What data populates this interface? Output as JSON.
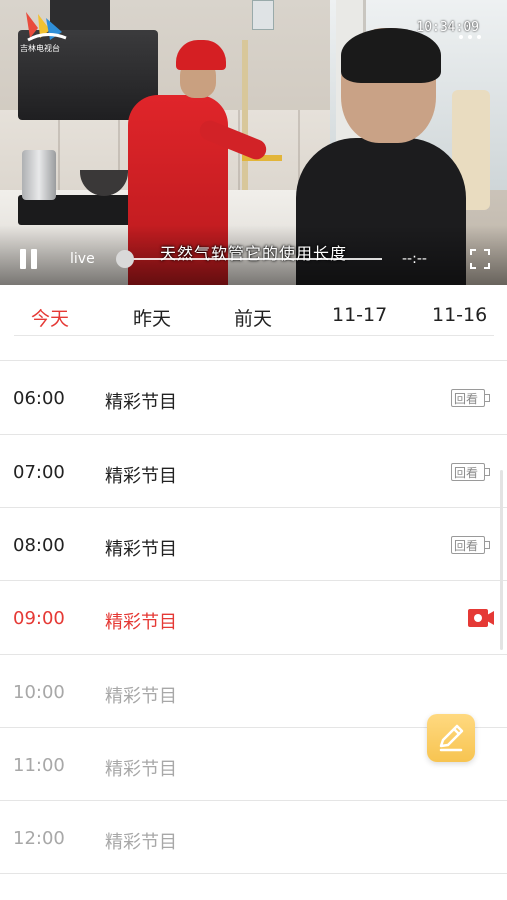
{
  "player": {
    "logo_text": "吉林电视台",
    "clock": "10:34:09",
    "subtitle": "天然气软管它的使用长度",
    "live_label": "live",
    "time_remaining": "--:--",
    "icons": [
      "pause-icon",
      "fullscreen-icon",
      "more-icon",
      "station-logo"
    ]
  },
  "tabs": [
    {
      "label": "今天",
      "active": true
    },
    {
      "label": "昨天",
      "active": false
    },
    {
      "label": "前天",
      "active": false
    },
    {
      "label": "11-17",
      "active": false
    },
    {
      "label": "11-16",
      "active": false
    }
  ],
  "programs": [
    {
      "time": "06:00",
      "title": "精彩节目",
      "status": "replay",
      "action": "回看"
    },
    {
      "time": "07:00",
      "title": "精彩节目",
      "status": "replay",
      "action": "回看"
    },
    {
      "time": "08:00",
      "title": "精彩节目",
      "status": "replay",
      "action": "回看"
    },
    {
      "time": "09:00",
      "title": "精彩节目",
      "status": "live",
      "action": "live-camera-icon"
    },
    {
      "time": "10:00",
      "title": "精彩节目",
      "status": "future",
      "action": ""
    },
    {
      "time": "11:00",
      "title": "精彩节目",
      "status": "future",
      "action": ""
    },
    {
      "time": "12:00",
      "title": "精彩节目",
      "status": "future",
      "action": ""
    }
  ],
  "colors": {
    "accent": "#e53935",
    "future_text": "#a8a8a8",
    "fab": "#f7c451"
  },
  "fab_icon": "pencil-edit-icon"
}
